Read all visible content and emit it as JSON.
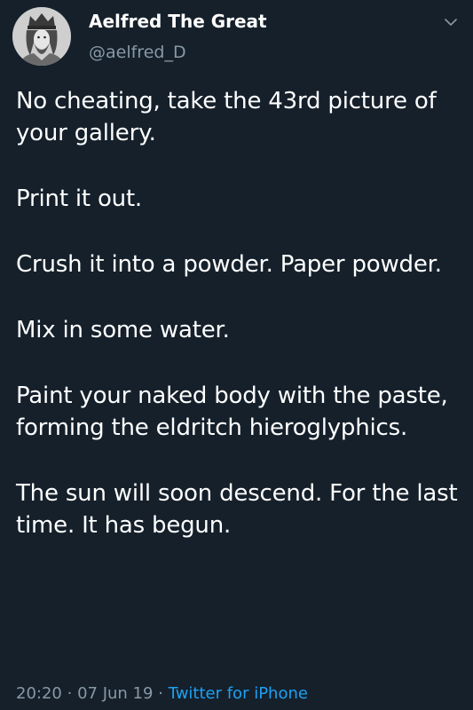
{
  "author": {
    "display_name": "Aelfred The Great",
    "handle": "@aelfred_D",
    "avatar_icon": "king-portrait-avatar"
  },
  "menu": {
    "icon": "chevron-down-icon"
  },
  "tweet": {
    "paragraphs": [
      "No cheating, take the 43rd picture of your gallery.",
      "Print it out.",
      "Crush it into a powder. Paper powder.",
      "Mix in some water.",
      "Paint your naked body with the paste, forming the eldritch hieroglyphics.",
      "The sun will soon descend. For the last time. It has begun."
    ]
  },
  "meta": {
    "time": "20:20",
    "separator": "·",
    "date": "07 Jun 19",
    "source": "Twitter for iPhone"
  },
  "colors": {
    "background": "#15202b",
    "text": "#ffffff",
    "secondary": "#8899a6",
    "link": "#1da1f2"
  }
}
